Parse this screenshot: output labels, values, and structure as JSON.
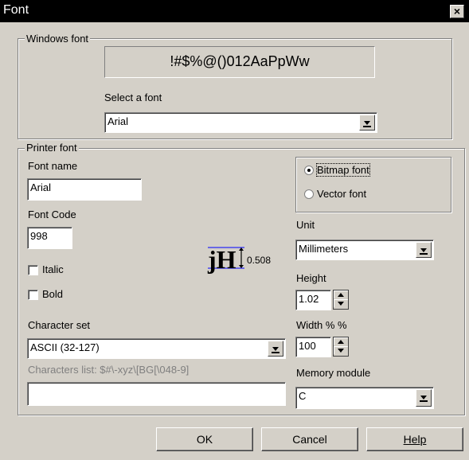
{
  "window": {
    "title": "Font",
    "close_glyph": "×"
  },
  "windows_font": {
    "group_label": "Windows font",
    "preview_text": "!#$%@()012AaPpWw",
    "select_label": "Select a font",
    "selected_font": "Arial"
  },
  "printer_font": {
    "group_label": "Printer font",
    "font_name_label": "Font name",
    "font_name_value": "Arial",
    "font_code_label": "Font Code",
    "font_code_value": "998",
    "italic_label": "Italic",
    "italic_checked": false,
    "bold_label": "Bold",
    "bold_checked": false,
    "preview_glyphs": "jH",
    "preview_size": "0.508",
    "font_type": {
      "bitmap_label": "Bitmap font",
      "vector_label": "Vector font",
      "selected": "bitmap"
    },
    "unit_label": "Unit",
    "unit_value": "Millimeters",
    "height_label": "Height",
    "height_value": "1.02",
    "width_label": "Width % %",
    "width_value": "100",
    "charset_label": "Character set",
    "charset_value": "ASCII (32-127)",
    "chars_list_label": "Characters list: $#\\-xyz\\[BG[\\048-9]",
    "chars_list_value": "",
    "memory_label": "Memory module",
    "memory_value": "C"
  },
  "buttons": {
    "ok": "OK",
    "cancel": "Cancel",
    "help": "Help"
  },
  "colors": {
    "dialog_bg": "#d4d0c8",
    "titlebar_bg": "#000000",
    "preview_marker": "#0000ff"
  }
}
